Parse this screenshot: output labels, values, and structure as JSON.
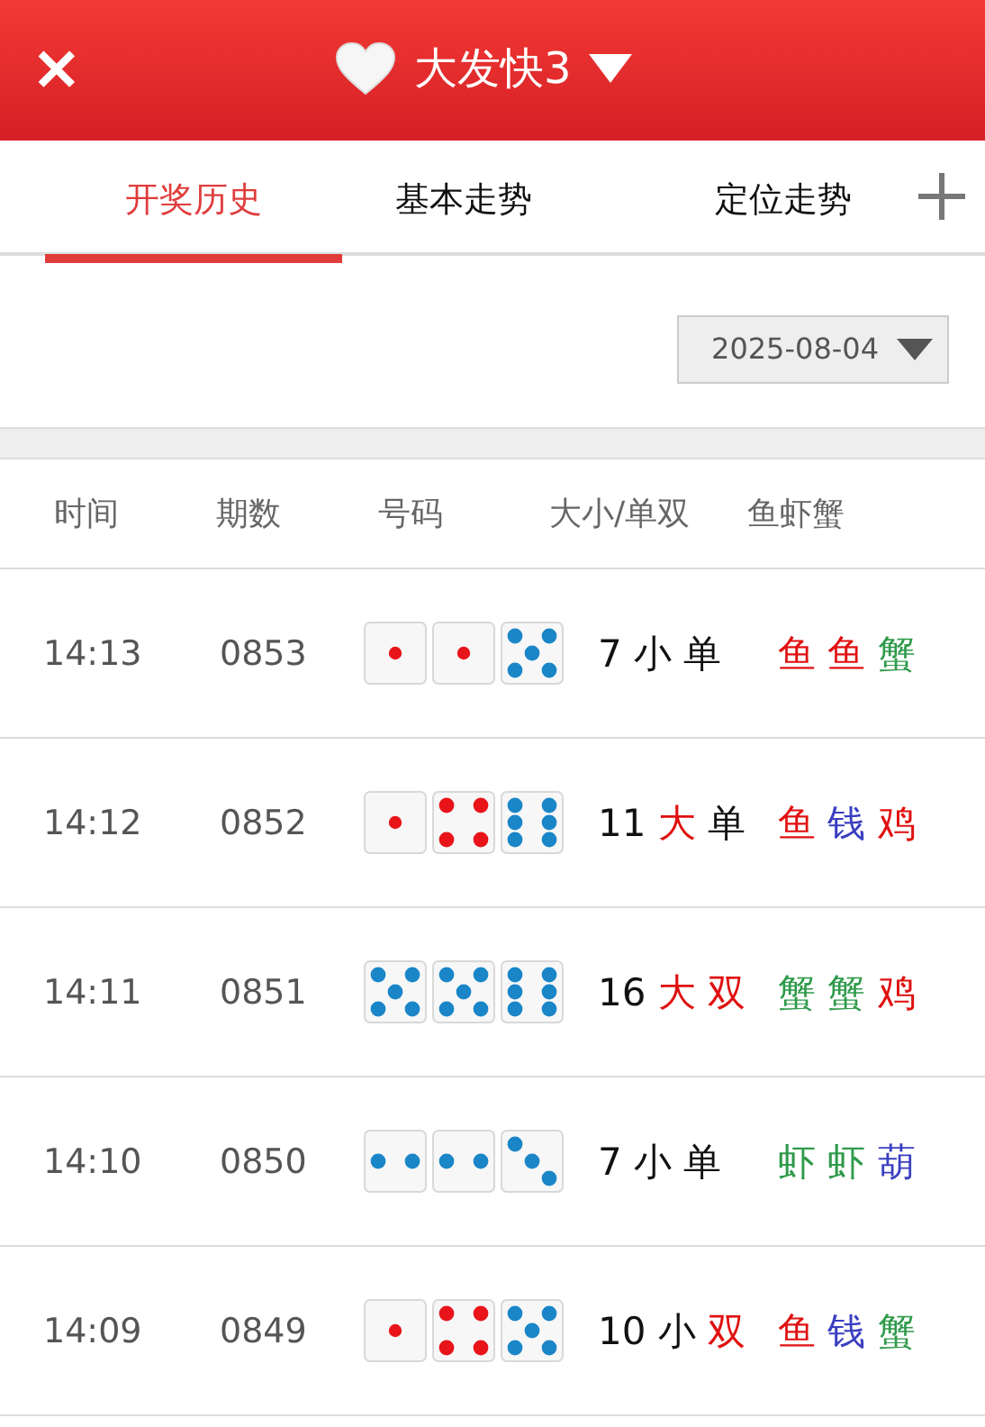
{
  "header": {
    "close": "✕",
    "title": "大发快3"
  },
  "tabs": [
    {
      "label": "开奖历史",
      "selected": true
    },
    {
      "label": "基本走势",
      "selected": false
    },
    {
      "label": "定位走势",
      "selected": false
    }
  ],
  "date": "2025-08-04",
  "columns": [
    "时间",
    "期数",
    "号码",
    "大小/单双",
    "鱼虾蟹"
  ],
  "rows": [
    {
      "time": "14:13",
      "issue": "0853",
      "dice": [
        {
          "kind": "one"
        },
        {
          "kind": "one"
        },
        {
          "kind": "five"
        }
      ],
      "sum": "7",
      "size": {
        "text": "小",
        "color": "#111111"
      },
      "parity": {
        "text": "单",
        "color": "#111111"
      },
      "animals": [
        {
          "text": "鱼",
          "color": "#e01010"
        },
        {
          "text": "鱼",
          "color": "#e01010"
        },
        {
          "text": "蟹",
          "color": "#2e9a4a"
        }
      ]
    },
    {
      "time": "14:12",
      "issue": "0852",
      "dice": [
        {
          "kind": "one"
        },
        {
          "kind": "four"
        },
        {
          "kind": "six"
        }
      ],
      "sum": "11",
      "size": {
        "text": "大",
        "color": "#e01010"
      },
      "parity": {
        "text": "单",
        "color": "#111111"
      },
      "animals": [
        {
          "text": "鱼",
          "color": "#e01010"
        },
        {
          "text": "钱",
          "color": "#3a3fc0"
        },
        {
          "text": "鸡",
          "color": "#e01010"
        }
      ]
    },
    {
      "time": "14:11",
      "issue": "0851",
      "dice": [
        {
          "kind": "five"
        },
        {
          "kind": "five"
        },
        {
          "kind": "six"
        }
      ],
      "sum": "16",
      "size": {
        "text": "大",
        "color": "#e01010"
      },
      "parity": {
        "text": "双",
        "color": "#e01010"
      },
      "animals": [
        {
          "text": "蟹",
          "color": "#2e9a4a"
        },
        {
          "text": "蟹",
          "color": "#2e9a4a"
        },
        {
          "text": "鸡",
          "color": "#e01010"
        }
      ]
    },
    {
      "time": "14:10",
      "issue": "0850",
      "dice": [
        {
          "kind": "two"
        },
        {
          "kind": "two"
        },
        {
          "kind": "three"
        }
      ],
      "sum": "7",
      "size": {
        "text": "小",
        "color": "#111111"
      },
      "parity": {
        "text": "单",
        "color": "#111111"
      },
      "animals": [
        {
          "text": "虾",
          "color": "#2e9a4a"
        },
        {
          "text": "虾",
          "color": "#2e9a4a"
        },
        {
          "text": "葫",
          "color": "#3a3fc0"
        }
      ]
    },
    {
      "time": "14:09",
      "issue": "0849",
      "dice": [
        {
          "kind": "one"
        },
        {
          "kind": "four"
        },
        {
          "kind": "five"
        }
      ],
      "sum": "10",
      "size": {
        "text": "小",
        "color": "#111111"
      },
      "parity": {
        "text": "双",
        "color": "#e01010"
      },
      "animals": [
        {
          "text": "鱼",
          "color": "#e01010"
        },
        {
          "text": "钱",
          "color": "#3a3fc0"
        },
        {
          "text": "蟹",
          "color": "#2e9a4a"
        }
      ]
    }
  ]
}
